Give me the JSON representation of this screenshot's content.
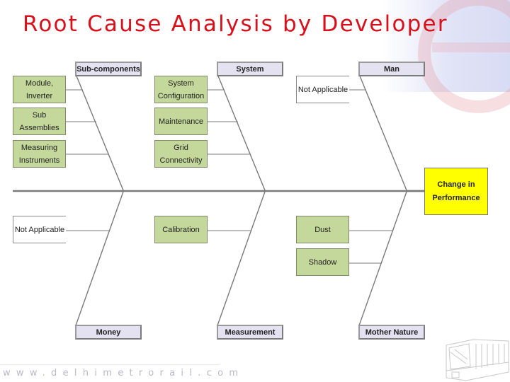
{
  "title": "Root Cause Analysis by Developer",
  "diagram": {
    "type": "fishbone",
    "effect": {
      "line1": "Change in",
      "line2": "Performance",
      "color": "#ffff00"
    },
    "categories": {
      "sub_components": {
        "label": "Sub-components",
        "causes": [
          {
            "line1": "Module,",
            "line2": "Inverter"
          },
          {
            "line1": "Sub Assemblies",
            "line2": ""
          },
          {
            "line1": "Measuring",
            "line2": "Instruments"
          }
        ]
      },
      "system": {
        "label": "System",
        "causes": [
          {
            "line1": "System",
            "line2": "Configuration"
          },
          {
            "line1": "Maintenance",
            "line2": ""
          },
          {
            "line1": "Grid",
            "line2": "Connectivity"
          }
        ]
      },
      "man": {
        "label": "Man",
        "causes": [
          {
            "line1": "Not Applicable",
            "line2": ""
          }
        ]
      },
      "money": {
        "label": "Money",
        "causes": [
          {
            "line1": "Not Applicable",
            "line2": ""
          }
        ]
      },
      "measurement": {
        "label": "Measurement",
        "causes": [
          {
            "line1": "Calibration",
            "line2": ""
          }
        ]
      },
      "mother_nature": {
        "label": "Mother Nature",
        "causes": [
          {
            "line1": "Dust",
            "line2": ""
          },
          {
            "line1": "Shadow",
            "line2": ""
          }
        ]
      }
    },
    "colors": {
      "category_fill": "#e4e1f0",
      "cause_fill": "#c5d89b",
      "line": "#7a7a7a"
    }
  },
  "footer": {
    "website": "www.delhimetrorail.com"
  }
}
